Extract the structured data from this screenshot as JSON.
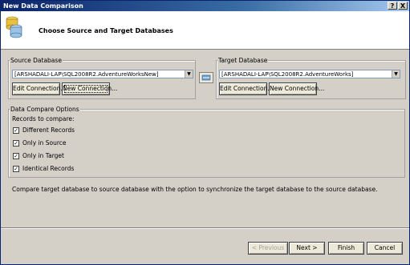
{
  "window": {
    "title": "New Data Comparison",
    "help_label": "?",
    "close_label": "X"
  },
  "header": {
    "title": "Choose Source and Target Databases"
  },
  "source": {
    "group_label": "Source Database",
    "selected": "[ARSHADALI-LAP\\SQL2008R2.AdventureWorksNew]",
    "edit_label": "Edit Connection...",
    "new_label": "New Connection..."
  },
  "target": {
    "group_label": "Target Database",
    "selected": "[ARSHADALI-LAP\\SQL2008R2.AdventureWorks]",
    "edit_label": "Edit Connection...",
    "new_label": "New Connection..."
  },
  "options": {
    "group_label": "Data Compare Options",
    "records_label": "Records to compare:",
    "items": [
      {
        "label": "Different Records",
        "checked": true
      },
      {
        "label": "Only in Source",
        "checked": true
      },
      {
        "label": "Only in Target",
        "checked": true
      },
      {
        "label": "Identical Records",
        "checked": true
      }
    ]
  },
  "description": "Compare target database to source database with the option to synchronize the target database to the source database.",
  "footer": {
    "previous_label": "< Previous",
    "next_label": "Next >",
    "finish_label": "Finish",
    "cancel_label": "Cancel"
  },
  "icons": {
    "database": "database-icon",
    "swap": "swap-icon",
    "dropdown": "chevron-down-icon"
  },
  "colors": {
    "titlebar": "#0a246a",
    "dialog": "#d4d0c8",
    "header": "#ffffff"
  }
}
